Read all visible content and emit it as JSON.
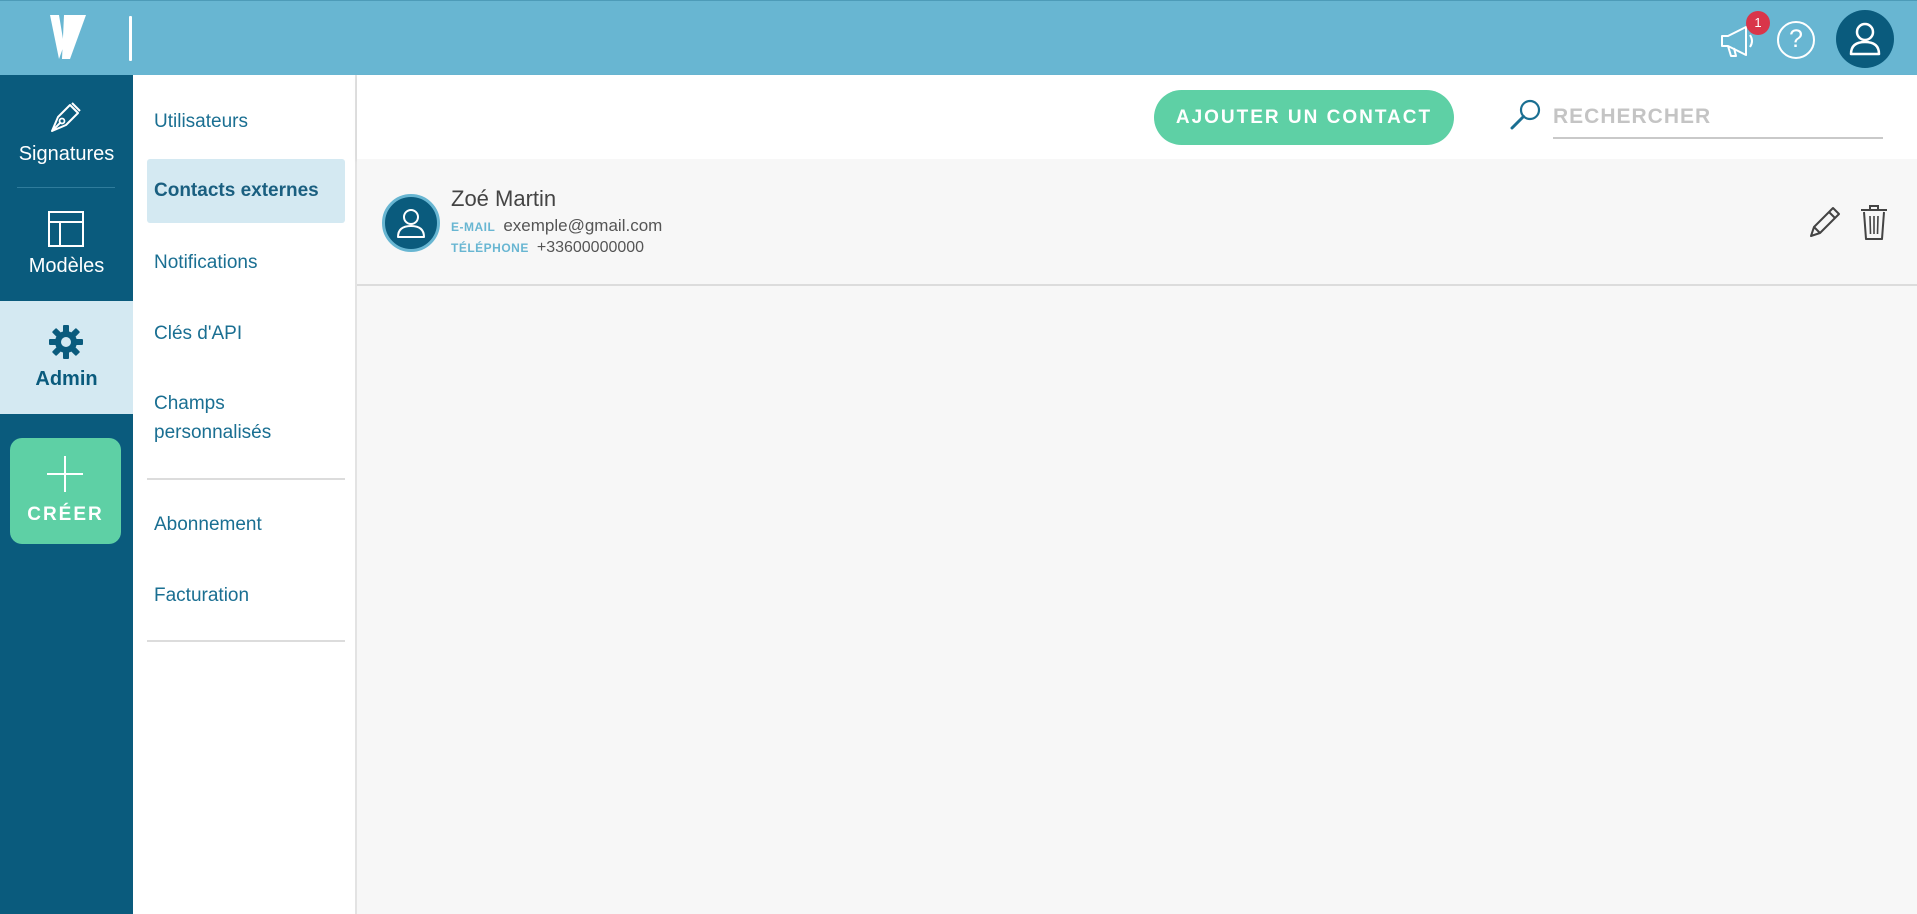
{
  "topbar": {
    "notifications_count": "1",
    "help_label": "?"
  },
  "rail": {
    "items": [
      {
        "label": "Signatures"
      },
      {
        "label": "Modèles"
      },
      {
        "label": "Admin"
      }
    ],
    "create_label": "CRÉER"
  },
  "subnav": {
    "items": [
      {
        "label": "Utilisateurs"
      },
      {
        "label": "Contacts externes"
      },
      {
        "label": "Notifications"
      },
      {
        "label": "Clés d'API"
      },
      {
        "label": "Champs personnalisés"
      },
      {
        "label": "Abonnement"
      },
      {
        "label": "Facturation"
      }
    ],
    "active_index": 1
  },
  "main": {
    "add_contact_label": "AJOUTER UN CONTACT",
    "search_placeholder": "RECHERCHER",
    "contacts": [
      {
        "name": "Zoé Martin",
        "email_label": "E-MAIL",
        "email": "exemple@gmail.com",
        "phone_label": "TÉLÉPHONE",
        "phone": "+33600000000"
      }
    ]
  },
  "colors": {
    "topbar": "#68b6d2",
    "rail": "#0a5b7d",
    "accent_green": "#5ed0a5",
    "active_bg": "#d4e9f2",
    "badge": "#d9354a"
  }
}
